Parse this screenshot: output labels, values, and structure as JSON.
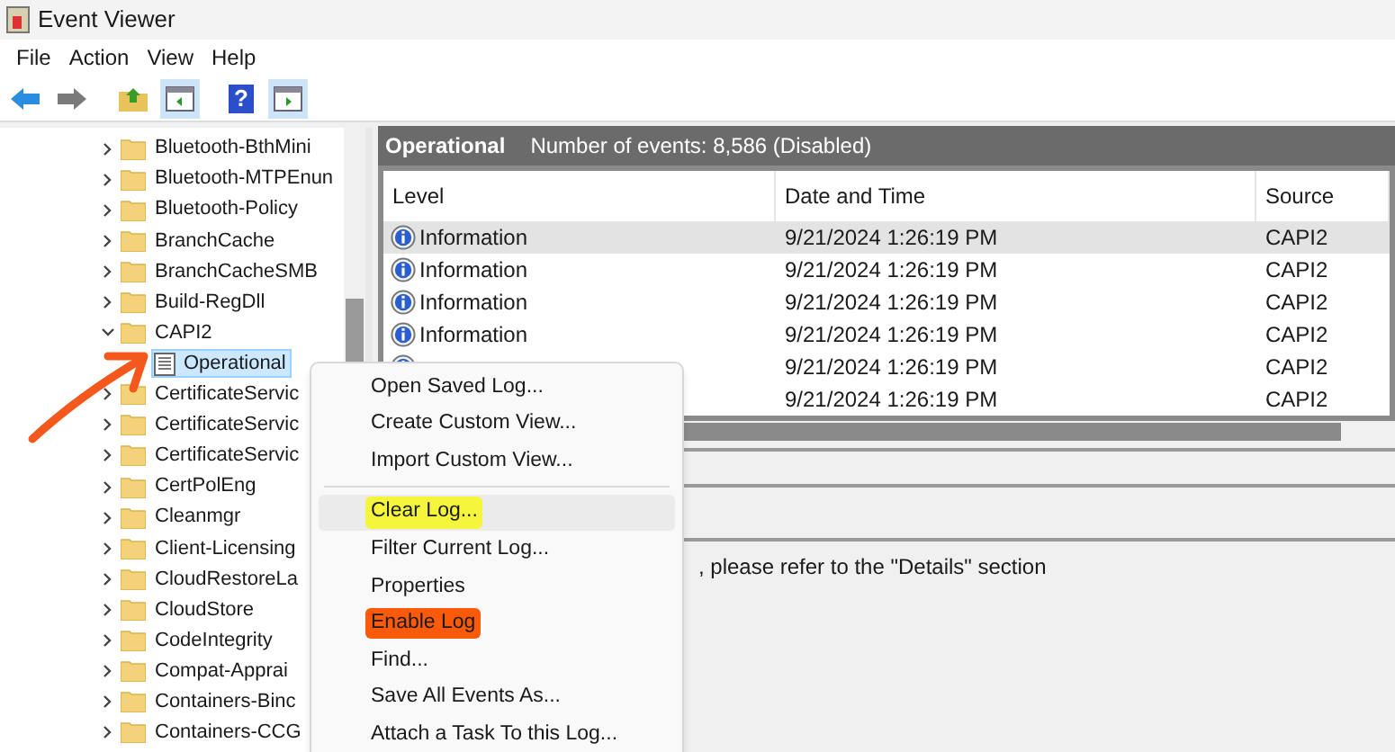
{
  "window": {
    "title": "Event Viewer"
  },
  "menu_bar": [
    "File",
    "Action",
    "View",
    "Help"
  ],
  "toolbar": [
    {
      "kind": "back",
      "pressed": false
    },
    {
      "kind": "forward",
      "pressed": false
    },
    {
      "kind": "up",
      "pressed": false
    },
    {
      "kind": "tree",
      "pressed": true
    },
    {
      "kind": "help",
      "pressed": false,
      "label": "?"
    },
    {
      "kind": "actions",
      "pressed": true
    }
  ],
  "tree": [
    {
      "label": "Bluetooth-BthMini",
      "expanded": false
    },
    {
      "label": "Bluetooth-MTPEnun",
      "expanded": false
    },
    {
      "label": "Bluetooth-Policy",
      "expanded": false
    },
    {
      "label": "BranchCache",
      "expanded": false
    },
    {
      "label": "BranchCacheSMB",
      "expanded": false
    },
    {
      "label": "Build-RegDll",
      "expanded": false
    },
    {
      "label": "CAPI2",
      "expanded": true,
      "children": [
        {
          "label": "Operational",
          "selected": true
        }
      ]
    },
    {
      "label": "CertificateServic",
      "expanded": false
    },
    {
      "label": "CertificateServic",
      "expanded": false
    },
    {
      "label": "CertificateServic",
      "expanded": false
    },
    {
      "label": "CertPolEng",
      "expanded": false
    },
    {
      "label": "Cleanmgr",
      "expanded": false
    },
    {
      "label": "Client-Licensing",
      "expanded": false
    },
    {
      "label": "CloudRestoreLa",
      "expanded": false
    },
    {
      "label": "CloudStore",
      "expanded": false
    },
    {
      "label": "CodeIntegrity",
      "expanded": false
    },
    {
      "label": "Compat-Apprai",
      "expanded": false
    },
    {
      "label": "Containers-Binc",
      "expanded": false
    },
    {
      "label": "Containers-CCG",
      "expanded": false
    }
  ],
  "log_header": {
    "name": "Operational",
    "summary": "Number of events: 8,586 (Disabled)"
  },
  "table": {
    "columns": [
      "Level",
      "Date and Time",
      "Source"
    ],
    "rows": [
      {
        "level": "Information",
        "date": "9/21/2024 1:26:19 PM",
        "source": "CAPI2",
        "selected": true
      },
      {
        "level": "Information",
        "date": "9/21/2024 1:26:19 PM",
        "source": "CAPI2",
        "selected": false
      },
      {
        "level": "Information",
        "date": "9/21/2024 1:26:19 PM",
        "source": "CAPI2",
        "selected": false
      },
      {
        "level": "Information",
        "date": "9/21/2024 1:26:19 PM",
        "source": "CAPI2",
        "selected": false
      },
      {
        "date": "9/21/2024 1:26:19 PM",
        "source": "CAPI2",
        "selected": false
      },
      {
        "date": "9/21/2024 1:26:19 PM",
        "source": "CAPI2",
        "selected": false
      }
    ]
  },
  "details_text": ", please refer to the \"Details\" section",
  "context_menu": [
    {
      "kind": "item",
      "label": "Open Saved Log...",
      "hovered": false
    },
    {
      "kind": "item",
      "label": "Create Custom View...",
      "hovered": false
    },
    {
      "kind": "item",
      "label": "Import Custom View...",
      "hovered": false
    },
    {
      "kind": "separator"
    },
    {
      "kind": "item",
      "label": "Clear Log...",
      "hovered": true,
      "color": "#f5f53c"
    },
    {
      "kind": "item",
      "label": "Filter Current Log...",
      "hovered": false
    },
    {
      "kind": "item",
      "label": "Properties",
      "hovered": false
    },
    {
      "kind": "item",
      "label": "Enable Log",
      "hovered": false,
      "color": "#fa5a0a"
    },
    {
      "kind": "item",
      "label": "Find...",
      "hovered": false
    },
    {
      "kind": "item",
      "label": "Save All Events As...",
      "hovered": false
    },
    {
      "kind": "item",
      "label": "Attach a Task To this Log...",
      "hovered": false
    }
  ]
}
